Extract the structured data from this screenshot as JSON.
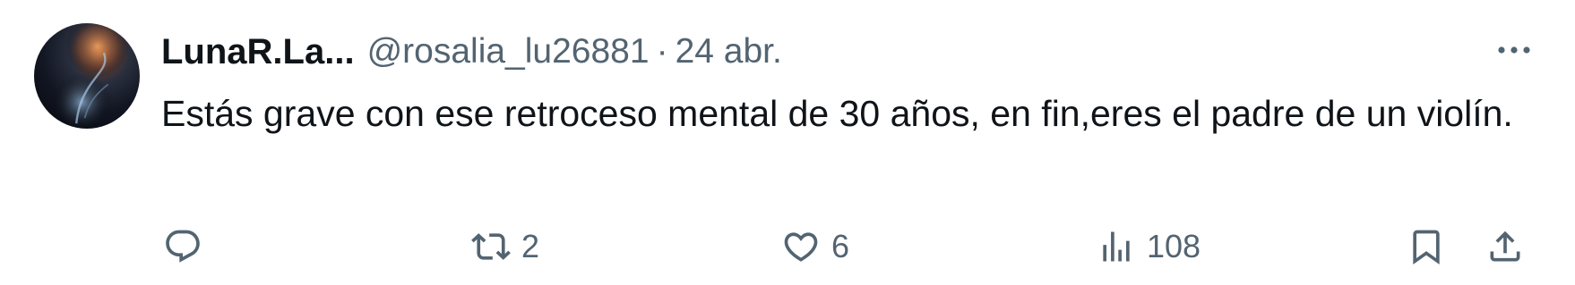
{
  "tweet": {
    "author": {
      "display_name": "LunaR.La...",
      "handle": "@rosalia_lu26881",
      "separator": "·",
      "date": "24 abr."
    },
    "text": "Estás grave con ese retroceso mental de 30 años, en fin,eres el padre de un violín."
  },
  "actions": {
    "reply": {
      "icon": "reply-icon",
      "count": ""
    },
    "retweet": {
      "icon": "retweet-icon",
      "count": "2"
    },
    "like": {
      "icon": "heart-icon",
      "count": "6"
    },
    "views": {
      "icon": "views-chart-icon",
      "count": "108"
    },
    "bookmark": {
      "icon": "bookmark-icon"
    },
    "share": {
      "icon": "share-icon"
    }
  },
  "more_menu": {
    "icon": "more-options-icon"
  },
  "colors": {
    "text_primary": "#0f1419",
    "text_secondary": "#536471",
    "background": "#ffffff"
  }
}
